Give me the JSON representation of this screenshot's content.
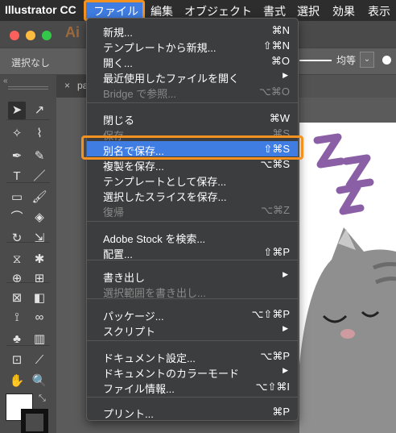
{
  "menubar": {
    "app": "Illustrator CC",
    "items": [
      "ファイル",
      "編集",
      "オブジェクト",
      "書式",
      "選択",
      "効果",
      "表示"
    ]
  },
  "app": {
    "logo": "Ai",
    "control_bar_label": "選択なし",
    "stroke_label": "均等",
    "doc_tab_close": "×",
    "doc_tab_name": "pa"
  },
  "colors": {
    "menu_bg": "#3c3d3e",
    "highlight": "#3f7de3",
    "callout": "#f39220",
    "traffic_red": "#fc605c",
    "traffic_yellow": "#fdbc40",
    "traffic_green": "#34c84a",
    "cat_body": "#8f8f8f",
    "sleep_z": "#8a5fa6"
  },
  "file_menu": [
    {
      "label": "新規...",
      "shortcut": "⌘N",
      "disabled": false
    },
    {
      "label": "テンプレートから新規...",
      "shortcut": "⇧⌘N",
      "disabled": false
    },
    {
      "label": "開く...",
      "shortcut": "⌘O",
      "disabled": false
    },
    {
      "label": "最近使用したファイルを開く",
      "shortcut": "▶",
      "disabled": false
    },
    {
      "label": "Bridge で参照...",
      "shortcut": "⌥⌘O",
      "disabled": true
    },
    {
      "label": "閉じる",
      "shortcut": "⌘W",
      "disabled": false
    },
    {
      "label": "保存",
      "shortcut": "⌘S",
      "disabled": true
    },
    {
      "label": "別名で保存...",
      "shortcut": "⇧⌘S",
      "disabled": false,
      "highlighted": true
    },
    {
      "label": "複製を保存...",
      "shortcut": "⌥⌘S",
      "disabled": false
    },
    {
      "label": "テンプレートとして保存...",
      "shortcut": "",
      "disabled": false
    },
    {
      "label": "選択したスライスを保存...",
      "shortcut": "",
      "disabled": false
    },
    {
      "label": "復帰",
      "shortcut": "⌥⌘Z",
      "disabled": true
    },
    {
      "label": "Adobe Stock を検索...",
      "shortcut": "",
      "disabled": false
    },
    {
      "label": "配置...",
      "shortcut": "⇧⌘P",
      "disabled": false
    },
    {
      "label": "書き出し",
      "shortcut": "▶",
      "disabled": false
    },
    {
      "label": "選択範囲を書き出し...",
      "shortcut": "",
      "disabled": true
    },
    {
      "label": "パッケージ...",
      "shortcut": "⌥⇧⌘P",
      "disabled": false
    },
    {
      "label": "スクリプト",
      "shortcut": "▶",
      "disabled": false
    },
    {
      "label": "ドキュメント設定...",
      "shortcut": "⌥⌘P",
      "disabled": false
    },
    {
      "label": "ドキュメントのカラーモード",
      "shortcut": "▶",
      "disabled": false
    },
    {
      "label": "ファイル情報...",
      "shortcut": "⌥⇧⌘I",
      "disabled": false
    },
    {
      "label": "プリント...",
      "shortcut": "⌘P",
      "disabled": false
    }
  ],
  "tools": [
    "selection-tool-icon",
    "direct-selection-tool-icon",
    "magic-wand-tool-icon",
    "lasso-tool-icon",
    "pen-tool-icon",
    "curvature-tool-icon",
    "type-tool-icon",
    "line-segment-tool-icon",
    "rectangle-tool-icon",
    "paintbrush-tool-icon",
    "shaper-tool-icon",
    "eraser-tool-icon",
    "rotate-tool-icon",
    "scale-tool-icon",
    "width-tool-icon",
    "puppet-warp-tool-icon",
    "shape-builder-tool-icon",
    "perspective-grid-tool-icon",
    "mesh-tool-icon",
    "gradient-tool-icon",
    "eyedropper-tool-icon",
    "blend-tool-icon",
    "symbol-sprayer-tool-icon",
    "column-graph-tool-icon",
    "artboard-tool-icon",
    "slice-tool-icon",
    "hand-tool-icon",
    "zoom-tool-icon"
  ]
}
